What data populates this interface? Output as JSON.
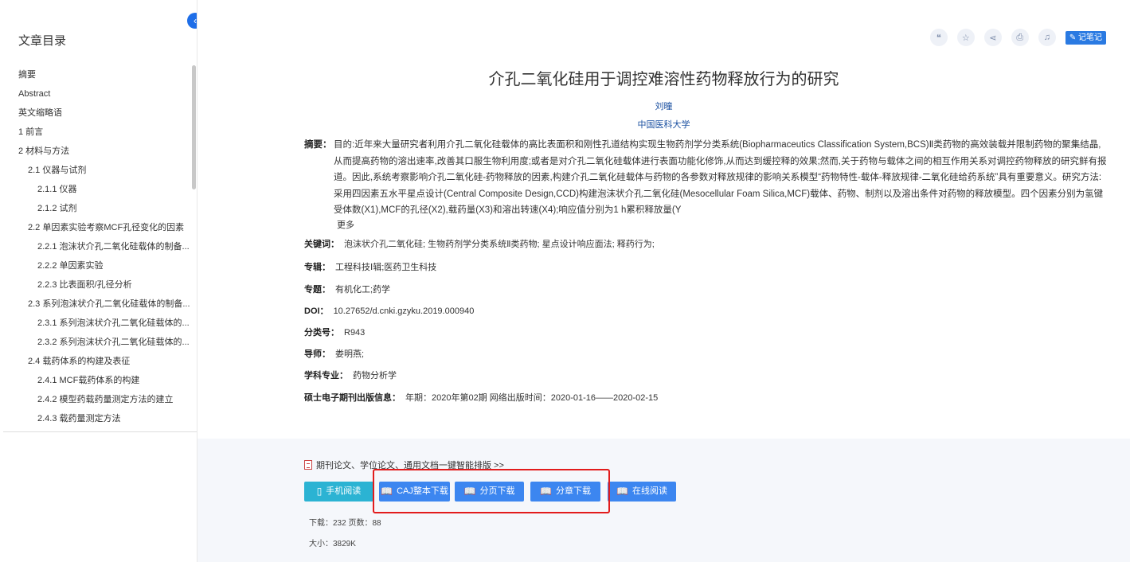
{
  "sidebar": {
    "title": "文章目录",
    "collapse_icon": "chevron-left-icon",
    "items": [
      {
        "label": "摘要",
        "level": 1
      },
      {
        "label": "Abstract",
        "level": 1
      },
      {
        "label": "英文缩略语",
        "level": 1
      },
      {
        "label": "1 前言",
        "level": 1
      },
      {
        "label": "2 材料与方法",
        "level": 1
      },
      {
        "label": "2.1 仪器与试剂",
        "level": 2
      },
      {
        "label": "2.1.1 仪器",
        "level": 3
      },
      {
        "label": "2.1.2 试剂",
        "level": 3
      },
      {
        "label": "2.2 单因素实验考察MCF孔径变化的因素",
        "level": 2
      },
      {
        "label": "2.2.1 泡沫状介孔二氧化硅载体的制备...",
        "level": 3
      },
      {
        "label": "2.2.2 单因素实验",
        "level": 3
      },
      {
        "label": "2.2.3 比表面积/孔径分析",
        "level": 3
      },
      {
        "label": "2.3 系列泡沫状介孔二氧化硅载体的制备...",
        "level": 2
      },
      {
        "label": "2.3.1 系列泡沫状介孔二氧化硅载体的...",
        "level": 3
      },
      {
        "label": "2.3.2 系列泡沫状介孔二氧化硅载体的...",
        "level": 3
      },
      {
        "label": "2.4 载药体系的构建及表征",
        "level": 2
      },
      {
        "label": "2.4.1 MCF载药体系的构建",
        "level": 3
      },
      {
        "label": "2.4.2 模型药载药量测定方法的建立",
        "level": 3
      },
      {
        "label": "2.4.3 载药量测定方法",
        "level": 3
      }
    ]
  },
  "toolbar": {
    "icons": [
      "quote-icon",
      "star-icon",
      "share-icon",
      "print-icon",
      "bell-icon"
    ],
    "note_label": "记笔记"
  },
  "paper": {
    "title": "介孔二氧化硅用于调控难溶性药物释放行为的研究",
    "author": "刘曈",
    "org": "中国医科大学",
    "abstract_label": "摘要：",
    "abstract": "目的:近年来大量研究者利用介孔二氧化硅载体的高比表面积和刚性孔道结构实现生物药剂学分类系统(Biopharmaceutics Classification System,BCS)Ⅱ类药物的高效装载并限制药物的聚集结晶,从而提高药物的溶出速率,改善其口服生物利用度;或者是对介孔二氧化硅载体进行表面功能化修饰,从而达到缓控释的效果;然而,关于药物与载体之间的相互作用关系对调控药物释放的研究鲜有报道。因此,系统考察影响介孔二氧化硅-药物释放的因素,构建介孔二氧化硅载体与药物的各参数对释放规律的影响关系模型“药物特性-载体-释放规律-二氧化硅给药系统”具有重要意义。研究方法:采用四因素五水平星点设计(Central Composite Design,CCD)构建泡沫状介孔二氧化硅(Mesocellular Foam Silica,MCF)载体、药物、制剂以及溶出条件对药物的释放模型。四个因素分别为氢键受体数(X1),MCF的孔径(X2),载药量(X3)和溶出转速(X4);响应值分别为1 h累积释放量(Y",
    "more_label": "更多",
    "meta": [
      {
        "label": "关键词：",
        "value": "泡沫状介孔二氧化硅;  生物药剂学分类系统Ⅱ类药物;  星点设计响应面法;  释药行为;"
      },
      {
        "label": "专辑：",
        "value": "工程科技Ⅰ辑;医药卫生科技"
      },
      {
        "label": "专题：",
        "value": "有机化工;药学"
      },
      {
        "label": "DOI：",
        "value": "10.27652/d.cnki.gzyku.2019.000940"
      },
      {
        "label": "分类号：",
        "value": "R943"
      },
      {
        "label": "导师：",
        "value": "娄明燕;"
      },
      {
        "label": "学科专业：",
        "value": "药物分析学"
      },
      {
        "label": "硕士电子期刊出版信息：",
        "value": "年期：2020年第02期      网络出版时间：2020-01-16——2020-02-15"
      }
    ]
  },
  "downloads": {
    "typeset_text": "期刊论文、学位论文、通用文档一键智能排版 >>",
    "buttons": [
      {
        "label": "手机阅读",
        "icon": "phone-icon"
      },
      {
        "label": "CAJ整本下载",
        "icon": "book-icon"
      },
      {
        "label": "分页下载",
        "icon": "book-icon"
      },
      {
        "label": "分章下载",
        "icon": "book-icon"
      },
      {
        "label": "在线阅读",
        "icon": "book-icon"
      }
    ],
    "stats_line1": "下载：232    页数：88",
    "stats_line2": "大小：3829K"
  }
}
